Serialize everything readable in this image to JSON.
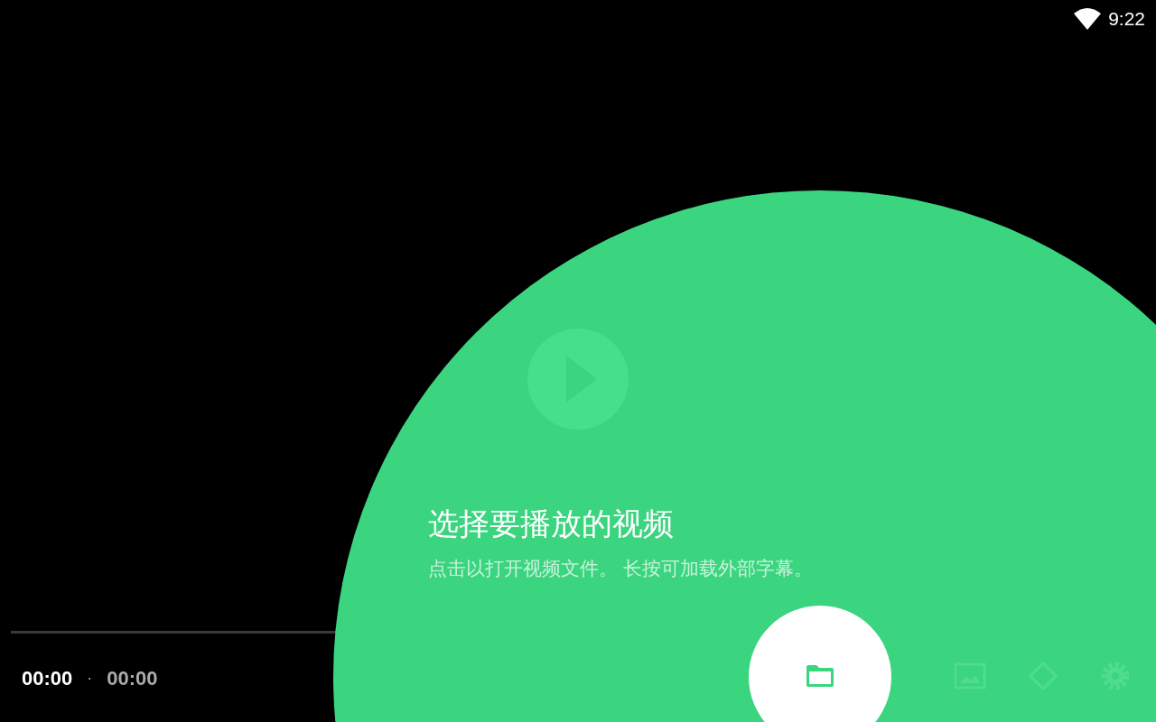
{
  "status_bar": {
    "time": "9:22"
  },
  "player": {
    "position": "00:00",
    "separator": "·",
    "duration": "00:00"
  },
  "tap_target": {
    "title": "选择要播放的视频",
    "description": "点击以打开视频文件。 长按可加载外部字幕。"
  }
}
